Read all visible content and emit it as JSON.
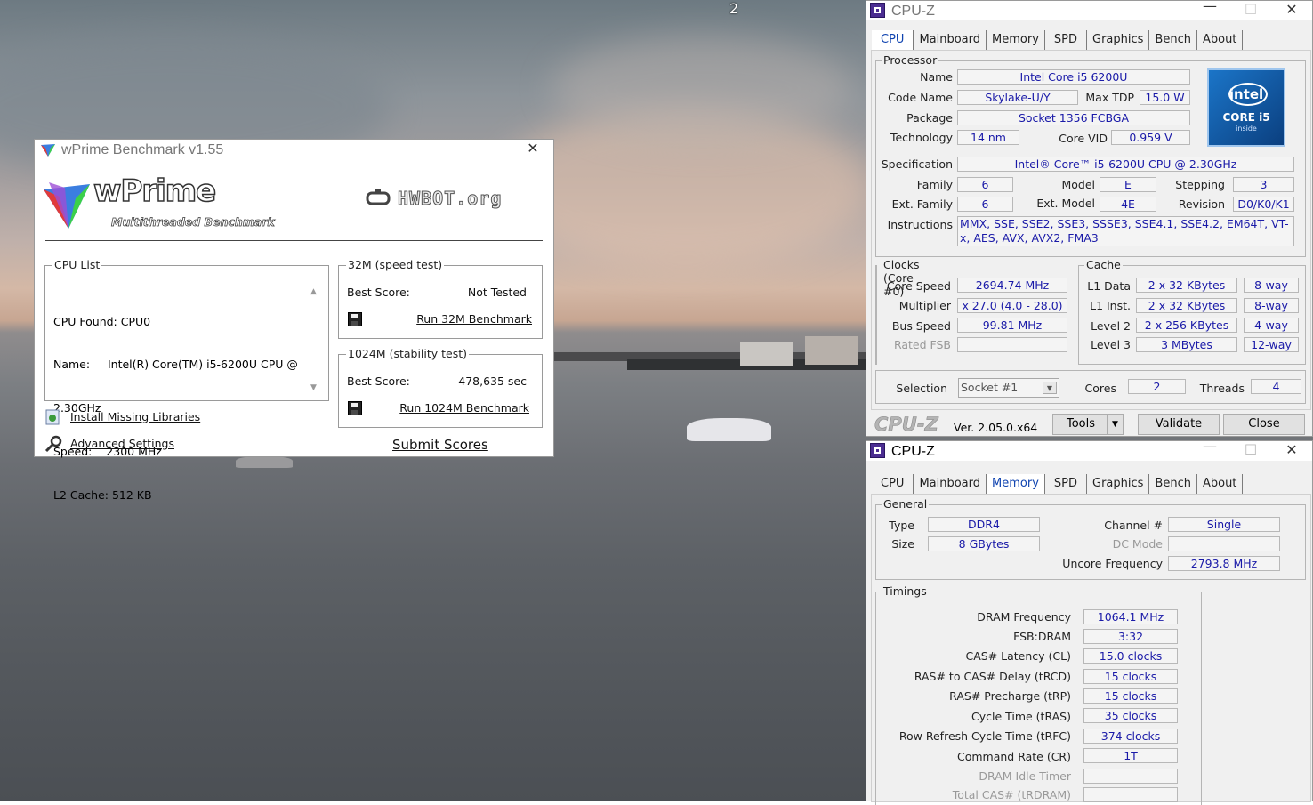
{
  "desktop": {
    "badge": "2"
  },
  "wprime": {
    "title": "wPrime Benchmark v1.55",
    "close_glyph": "✕",
    "logo_text": "wPrime",
    "logo_sub": "Multithreaded Benchmark",
    "hwbot_text": "HWBOT.org",
    "cpu_list": {
      "title": "CPU List",
      "lines": [
        "CPU Found: CPU0",
        "Name:     Intel(R) Core(TM) i5-6200U CPU @",
        "2.30GHz",
        "Speed:    2300 MHz",
        "L2 Cache: 512 KB"
      ]
    },
    "test32": {
      "title": "32M (speed test)",
      "best_label": "Best Score:",
      "best_value": "Not Tested",
      "run_label": "Run 32M Benchmark"
    },
    "test1024": {
      "title": "1024M (stability test)",
      "best_label": "Best Score:",
      "best_value": "478,635 sec",
      "run_label": "Run 1024M Benchmark"
    },
    "install_label": "Install Missing Libraries",
    "advanced_label": "Advanced Settings",
    "submit_label": "Submit Scores"
  },
  "cpuz1": {
    "title": "CPU-Z",
    "min_glyph": "—",
    "max_glyph": "☐",
    "close_glyph": "✕",
    "tabs": [
      "CPU",
      "Mainboard",
      "Memory",
      "SPD",
      "Graphics",
      "Bench",
      "About"
    ],
    "processor": {
      "group": "Processor",
      "name_label": "Name",
      "name": "Intel Core i5 6200U",
      "codename_label": "Code Name",
      "codename": "Skylake-U/Y",
      "maxtdp_label": "Max TDP",
      "maxtdp": "15.0 W",
      "package_label": "Package",
      "package": "Socket 1356 FCBGA",
      "tech_label": "Technology",
      "tech": "14 nm",
      "corevid_label": "Core VID",
      "corevid": "0.959 V",
      "spec_label": "Specification",
      "spec": "Intel® Core™ i5-6200U CPU @ 2.30GHz",
      "family_label": "Family",
      "family": "6",
      "model_label": "Model",
      "model": "E",
      "stepping_label": "Stepping",
      "stepping": "3",
      "extfamily_label": "Ext. Family",
      "extfamily": "6",
      "extmodel_label": "Ext. Model",
      "extmodel": "4E",
      "revision_label": "Revision",
      "revision": "D0/K0/K1",
      "instr_label": "Instructions",
      "instr": "MMX, SSE, SSE2, SSE3, SSSE3, SSE4.1, SSE4.2, EM64T, VT-x, AES, AVX, AVX2, FMA3",
      "badge_brand": "intel",
      "badge_model": "CORE i5",
      "badge_inside": "inside"
    },
    "clocks": {
      "group": "Clocks (Core #0)",
      "corespeed_label": "Core Speed",
      "corespeed": "2694.74 MHz",
      "mult_label": "Multiplier",
      "mult": "x 27.0 (4.0 - 28.0)",
      "bus_label": "Bus Speed",
      "bus": "99.81 MHz",
      "rated_label": "Rated FSB",
      "rated": ""
    },
    "cache": {
      "group": "Cache",
      "rows": [
        {
          "label": "L1 Data",
          "size": "2 x 32 KBytes",
          "way": "8-way"
        },
        {
          "label": "L1 Inst.",
          "size": "2 x 32 KBytes",
          "way": "8-way"
        },
        {
          "label": "Level 2",
          "size": "2 x 256 KBytes",
          "way": "4-way"
        },
        {
          "label": "Level 3",
          "size": "3 MBytes",
          "way": "12-way"
        }
      ]
    },
    "selection_label": "Selection",
    "selection": "Socket #1",
    "dropdown_glyph": "▼",
    "cores_label": "Cores",
    "cores": "2",
    "threads_label": "Threads",
    "threads": "4",
    "brand": "CPU-Z",
    "version": "Ver. 2.05.0.x64",
    "tools_label": "Tools",
    "validate_label": "Validate",
    "close_label": "Close"
  },
  "cpuz2": {
    "title": "CPU-Z",
    "tabs": [
      "CPU",
      "Mainboard",
      "Memory",
      "SPD",
      "Graphics",
      "Bench",
      "About"
    ],
    "general": {
      "group": "General",
      "type_label": "Type",
      "type": "DDR4",
      "size_label": "Size",
      "size": "8 GBytes",
      "channel_label": "Channel #",
      "channel": "Single",
      "dcmode_label": "DC Mode",
      "dcmode": "",
      "uncore_label": "Uncore Frequency",
      "uncore": "2793.8 MHz"
    },
    "timings": {
      "group": "Timings",
      "rows": [
        {
          "label": "DRAM Frequency",
          "value": "1064.1 MHz",
          "dim": false
        },
        {
          "label": "FSB:DRAM",
          "value": "3:32",
          "dim": false
        },
        {
          "label": "CAS# Latency (CL)",
          "value": "15.0 clocks",
          "dim": false
        },
        {
          "label": "RAS# to CAS# Delay (tRCD)",
          "value": "15 clocks",
          "dim": false
        },
        {
          "label": "RAS# Precharge (tRP)",
          "value": "15 clocks",
          "dim": false
        },
        {
          "label": "Cycle Time (tRAS)",
          "value": "35 clocks",
          "dim": false
        },
        {
          "label": "Row Refresh Cycle Time (tRFC)",
          "value": "374 clocks",
          "dim": false
        },
        {
          "label": "Command Rate (CR)",
          "value": "1T",
          "dim": false
        },
        {
          "label": "DRAM Idle Timer",
          "value": "",
          "dim": true
        },
        {
          "label": "Total CAS# (tRDRAM)",
          "value": "",
          "dim": true
        }
      ]
    }
  }
}
